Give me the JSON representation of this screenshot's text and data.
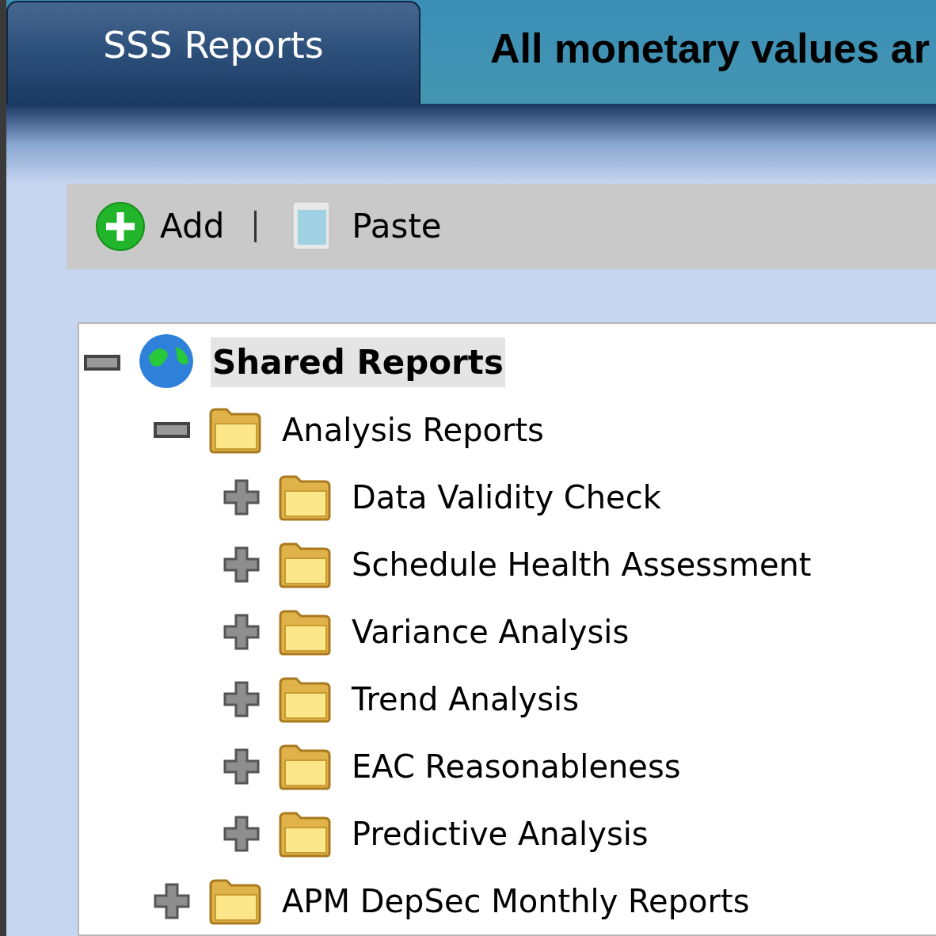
{
  "tabs": [
    {
      "label": "SSS Reports",
      "selected": true
    }
  ],
  "notice": "All monetary values ar",
  "toolbar": [
    {
      "kind": "add",
      "label": "Add"
    },
    {
      "kind": "paste",
      "label": "Paste"
    }
  ],
  "tree": [
    {
      "label": "Shared Reports",
      "kind": "globe",
      "expanded": true,
      "selected": true,
      "children": [
        {
          "label": "Analysis Reports",
          "kind": "folder",
          "expanded": true,
          "selected": false,
          "children": [
            {
              "label": "Data Validity Check",
              "kind": "folder",
              "expanded": false,
              "selected": false
            },
            {
              "label": "Schedule Health Assessment",
              "kind": "folder",
              "expanded": false,
              "selected": false
            },
            {
              "label": "Variance Analysis",
              "kind": "folder",
              "expanded": false,
              "selected": false
            },
            {
              "label": "Trend Analysis",
              "kind": "folder",
              "expanded": false,
              "selected": false
            },
            {
              "label": "EAC Reasonableness",
              "kind": "folder",
              "expanded": false,
              "selected": false
            },
            {
              "label": "Predictive Analysis",
              "kind": "folder",
              "expanded": false,
              "selected": false
            }
          ]
        },
        {
          "label": "APM DepSec Monthly Reports",
          "kind": "folder",
          "expanded": false,
          "selected": false
        }
      ]
    }
  ]
}
